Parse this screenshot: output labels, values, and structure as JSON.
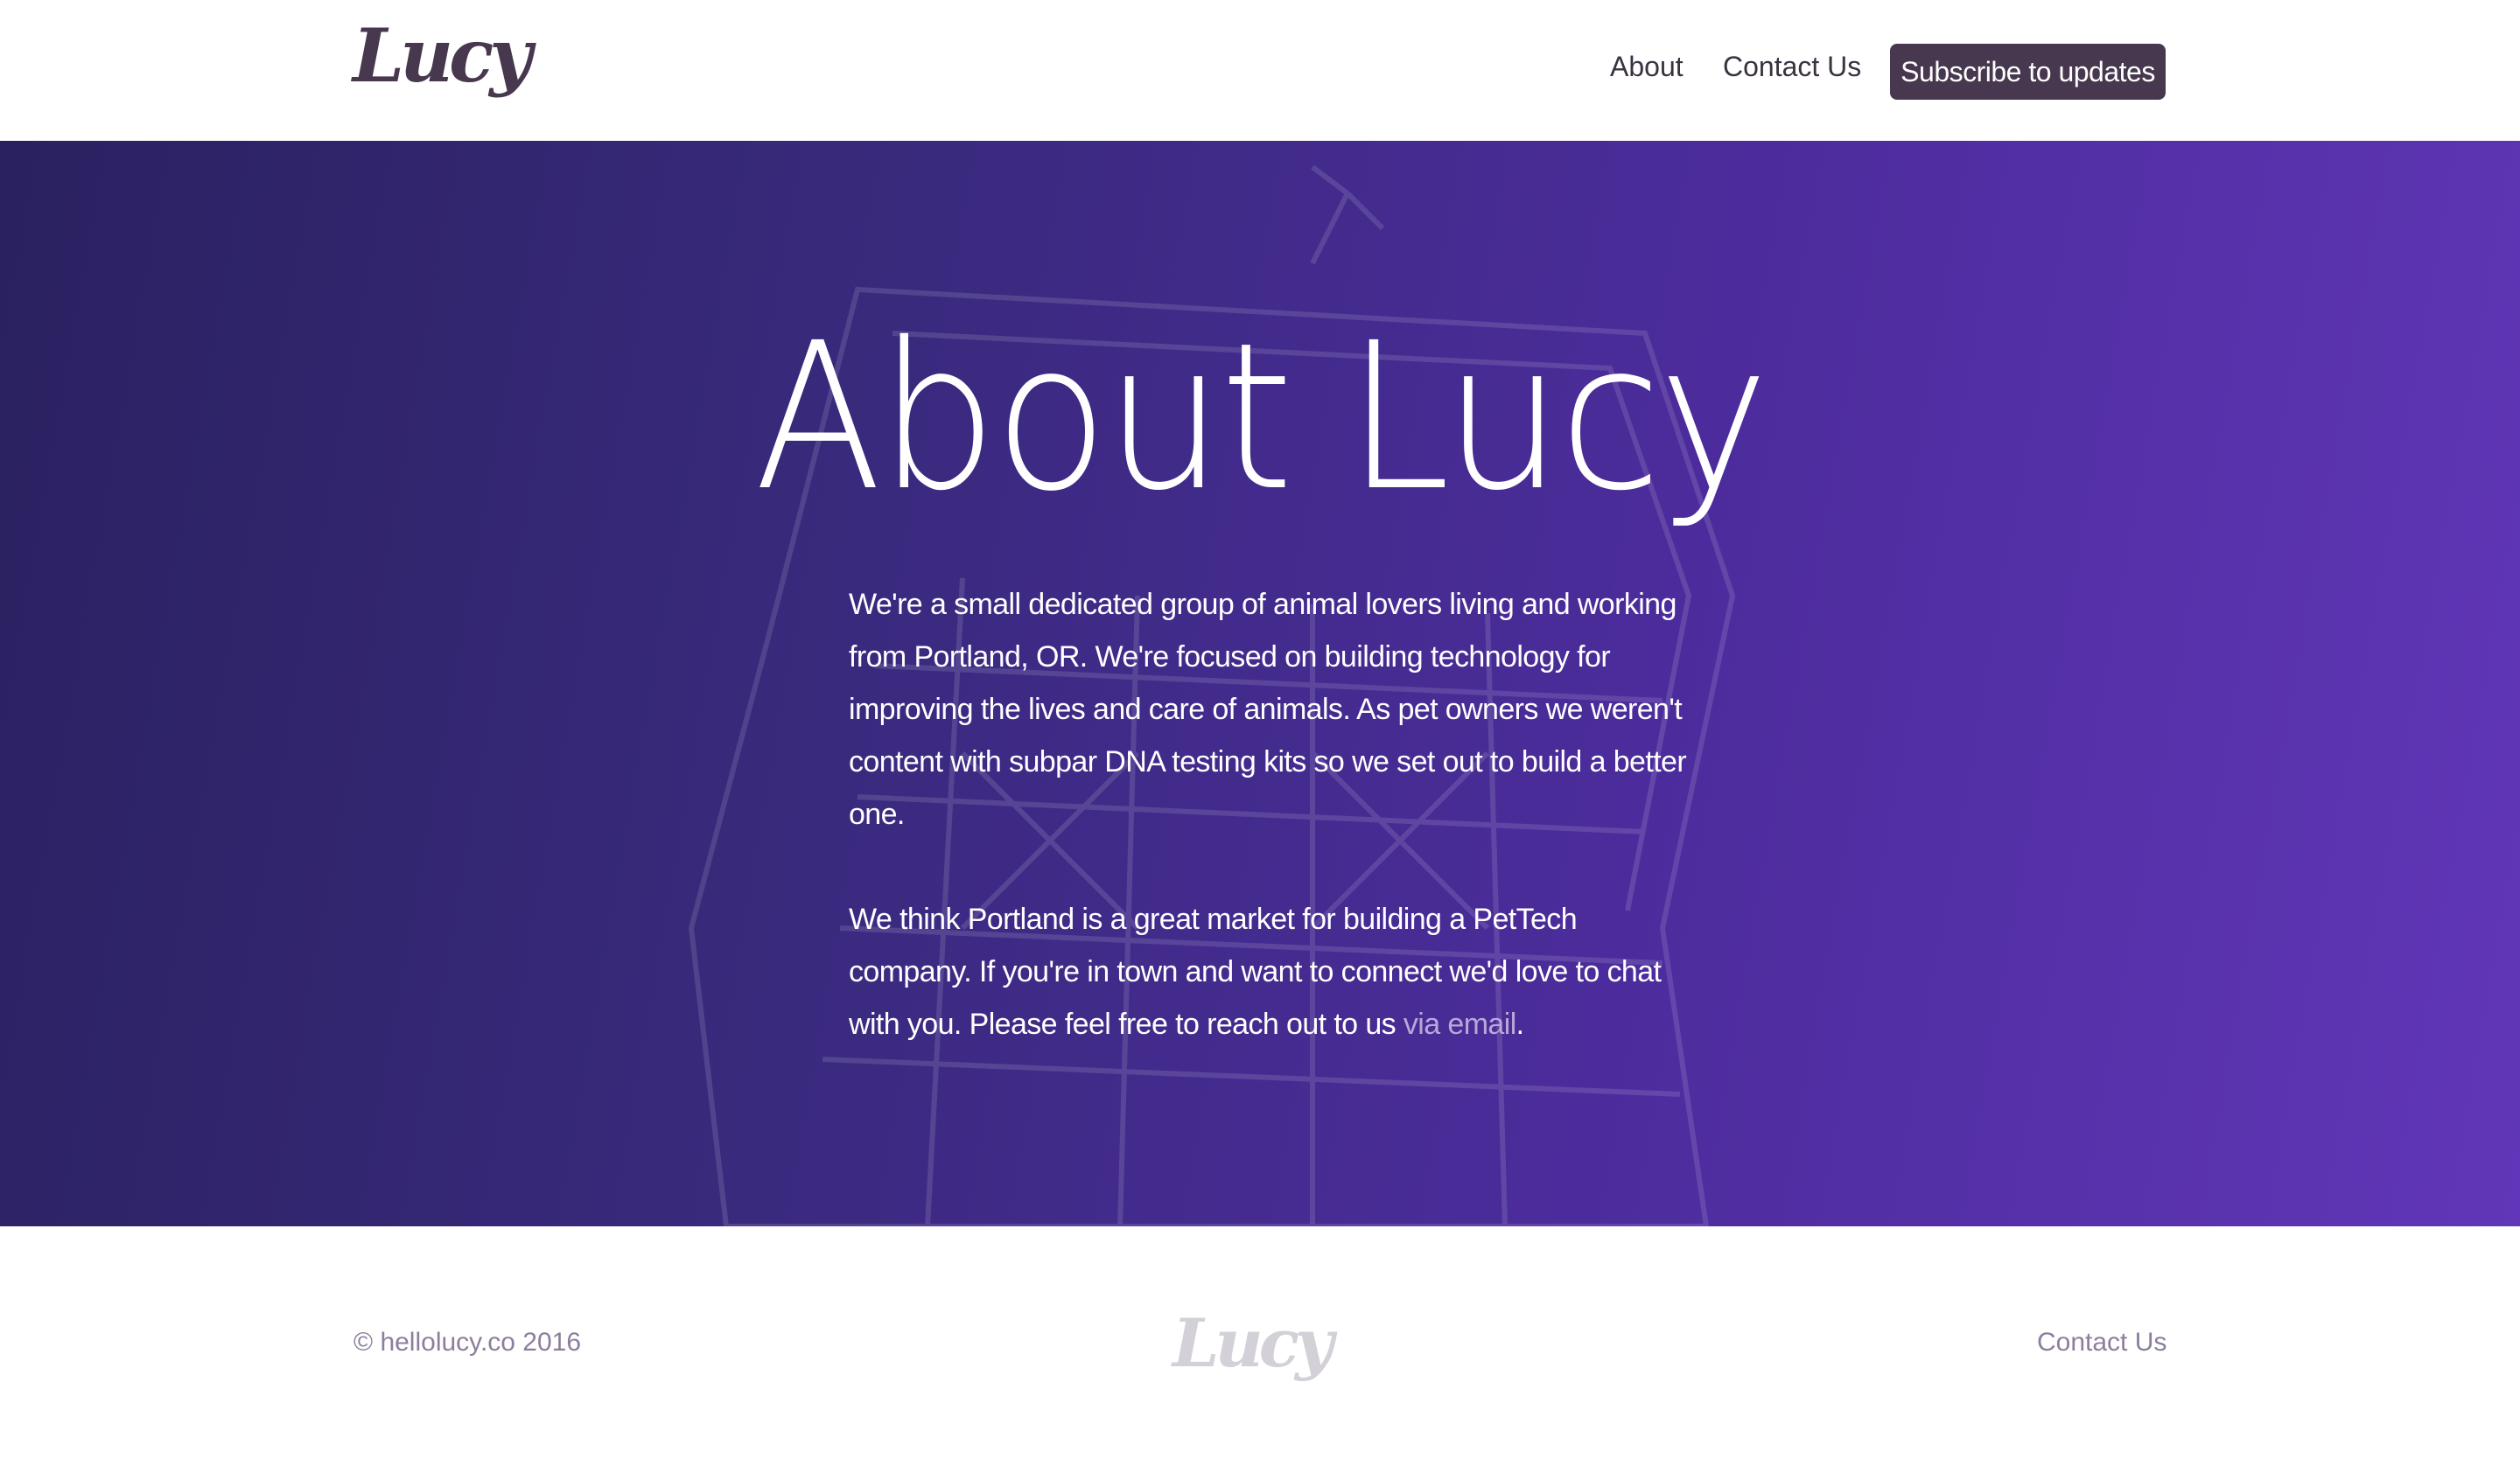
{
  "header": {
    "logo_text": "Lucy",
    "nav": {
      "about": "About",
      "contact": "Contact Us"
    },
    "subscribe_label": "Subscribe to updates"
  },
  "hero": {
    "title": "About Lucy",
    "paragraph1": "We're a small dedicated group of animal lovers living and working from Portland, OR. We're focused on building technology for improving the lives and care of animals. As pet owners we weren't content with subpar DNA testing kits so we set out to build a better one.",
    "paragraph2_text": "We think Portland is a great market for building a PetTech company. If you're in town and want to connect we'd love to chat with you. Please feel free to reach out to us ",
    "paragraph2_link": "via email",
    "paragraph2_end": "."
  },
  "footer": {
    "copyright": "© hellolucy.co 2016",
    "logo_text": "Lucy",
    "contact": "Contact Us"
  },
  "colors": {
    "brand": "#47384f",
    "hero_gradient_start": "#2a2160",
    "hero_gradient_end": "#6136b8",
    "link_muted": "#b6a8d8",
    "footer_text": "#8c7e9c"
  }
}
